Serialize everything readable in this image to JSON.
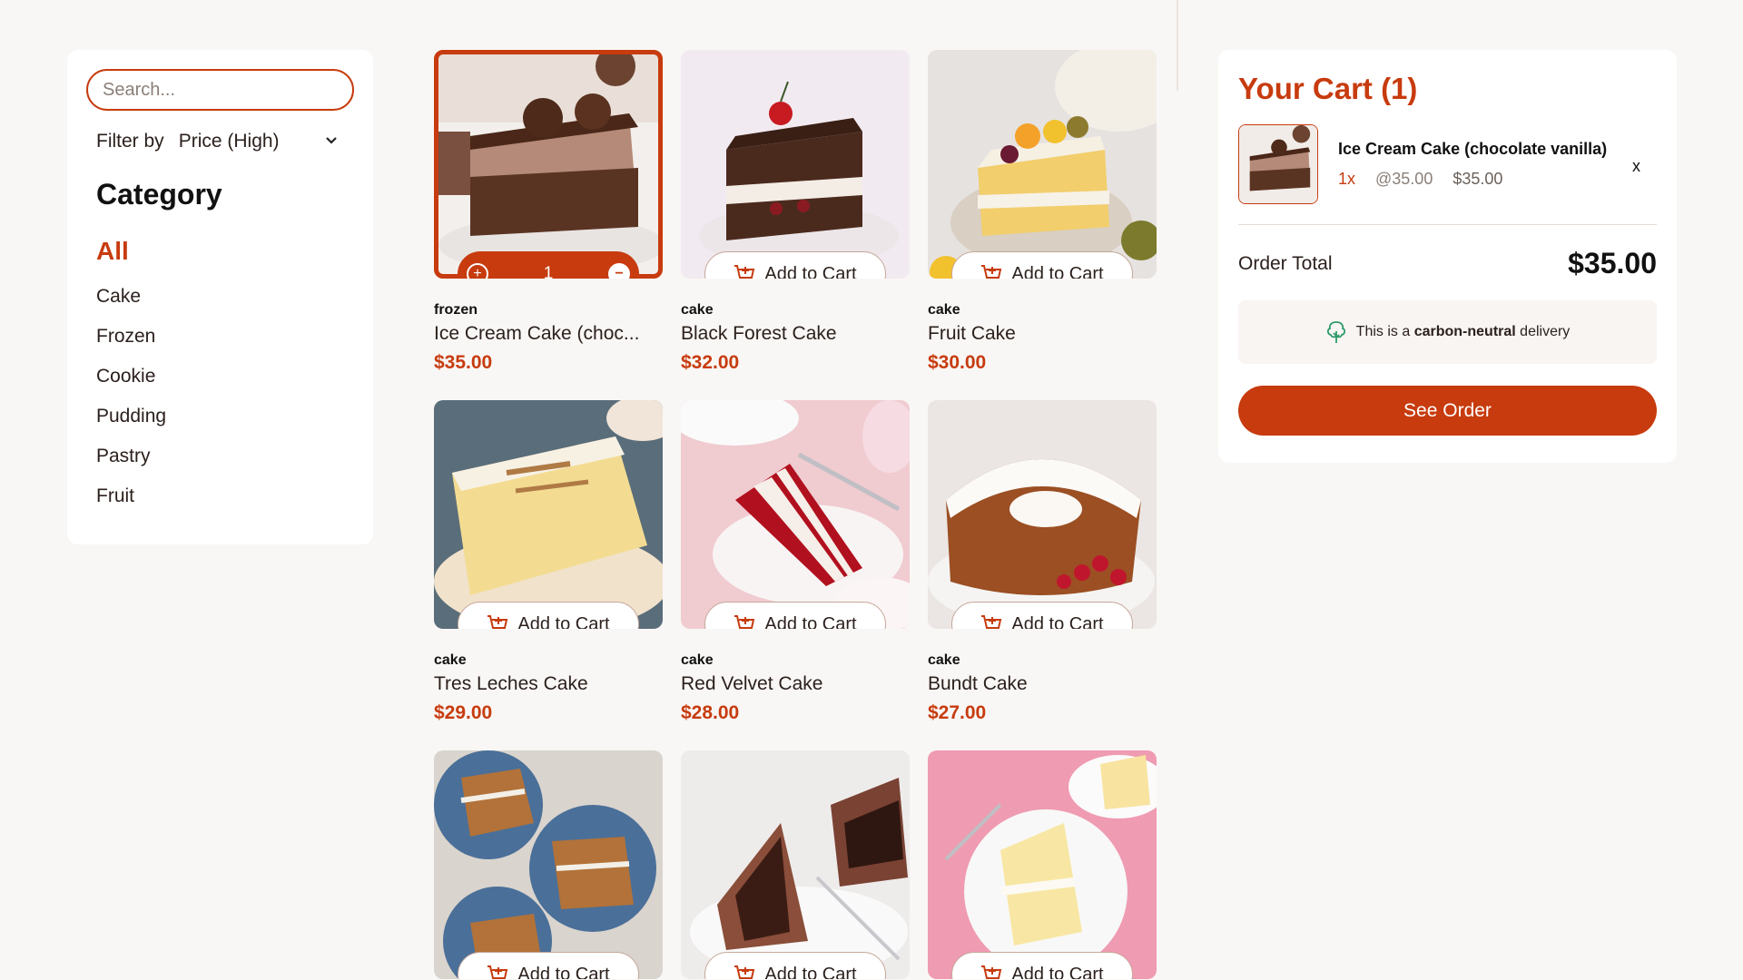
{
  "search": {
    "placeholder": "Search..."
  },
  "filter": {
    "label": "Filter by",
    "selected": "Price (High)",
    "chevron_icon": "chevron-down-icon"
  },
  "categories": {
    "title": "Category",
    "items": [
      {
        "label": "All",
        "active": true
      },
      {
        "label": "Cake"
      },
      {
        "label": "Frozen"
      },
      {
        "label": "Cookie"
      },
      {
        "label": "Pudding"
      },
      {
        "label": "Pastry"
      },
      {
        "label": "Fruit"
      }
    ]
  },
  "products": [
    {
      "category": "frozen",
      "name": "Ice Cream Cake (choc...",
      "price": "$35.00",
      "in_cart": true,
      "quantity": "1"
    },
    {
      "category": "cake",
      "name": "Black Forest Cake",
      "price": "$32.00",
      "button": "Add to Cart"
    },
    {
      "category": "cake",
      "name": "Fruit Cake",
      "price": "$30.00",
      "button": "Add to Cart"
    },
    {
      "category": "cake",
      "name": "Tres Leches Cake",
      "price": "$29.00",
      "button": "Add to Cart"
    },
    {
      "category": "cake",
      "name": "Red Velvet Cake",
      "price": "$28.00",
      "button": "Add to Cart"
    },
    {
      "category": "cake",
      "name": "Bundt Cake",
      "price": "$27.00",
      "button": "Add to Cart"
    },
    {
      "button": "Add to Cart"
    },
    {
      "button": "Add to Cart"
    },
    {
      "button": "Add to Cart"
    }
  ],
  "cart": {
    "title": "Your Cart (1)",
    "items": [
      {
        "name": "Ice Cream Cake (chocolate vanilla)",
        "qty": "1x",
        "unit_price": "@35.00",
        "line_total": "$35.00",
        "remove": "x"
      }
    ],
    "order_total_label": "Order Total",
    "order_total": "$35.00",
    "carbon_prefix": "This is a",
    "carbon_bold": "carbon-neutral",
    "carbon_suffix": "delivery",
    "see_order": "See Order"
  },
  "colors": {
    "accent": "#c73b0e",
    "background": "#f9f7f5"
  }
}
